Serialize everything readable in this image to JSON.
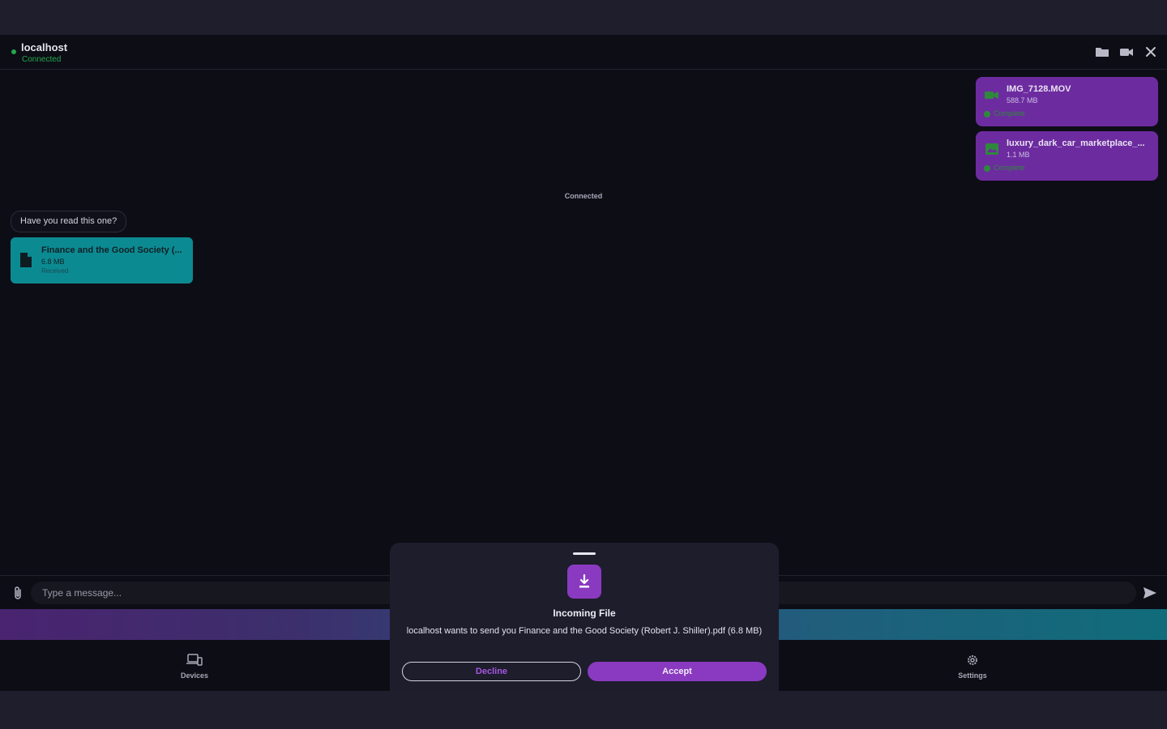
{
  "header": {
    "peer_name": "localhost",
    "peer_status": "Connected",
    "status_color": "#22a84a",
    "icons": [
      "folder-icon",
      "video-camera-icon",
      "close-icon"
    ]
  },
  "messages": {
    "sent_files": [
      {
        "name": "IMG_7128.MOV",
        "size": "588.7 MB",
        "status": "Complete",
        "icon": "video-icon"
      },
      {
        "name": "luxury_dark_car_marketplace_...",
        "size": "1.1 MB",
        "status": "Complete",
        "icon": "image-icon"
      }
    ],
    "connection_notice": "Connected",
    "received_text": "Have you read this one?",
    "received_file": {
      "name": "Finance and the Good Society (...",
      "size": "6.8 MB",
      "status": "Received",
      "icon": "document-icon"
    }
  },
  "composer": {
    "placeholder": "Type a message...",
    "attach_icon": "paperclip-icon",
    "send_icon": "send-icon"
  },
  "nav": {
    "items": [
      {
        "label": "Devices",
        "icon": "devices-icon"
      },
      {
        "label": "Settings",
        "icon": "gear-icon"
      }
    ]
  },
  "dialog": {
    "icon": "download-icon",
    "title": "Incoming File",
    "message": "localhost wants to send you Finance and the Good Society (Robert J. Shiller).pdf (6.8 MB)",
    "decline_label": "Decline",
    "accept_label": "Accept"
  },
  "colors": {
    "background": "#0d0d16",
    "accent": "#8a3ac0",
    "sent_bubble": "#6d2ba0",
    "received_bubble": "#0c8a92"
  }
}
